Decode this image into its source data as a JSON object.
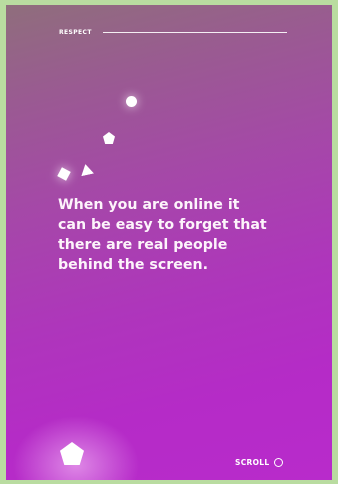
{
  "header": {
    "section_label": "RESPECT"
  },
  "main": {
    "quote_lines": [
      "When you are online it",
      "can be easy to forget that",
      "there are real people",
      "behind the screen."
    ]
  },
  "footer": {
    "scroll_label": "SCROLL",
    "scroll_icon": "circle-icon"
  },
  "colors": {
    "gradient_top": "#8f6e7c",
    "gradient_bottom": "#b82bcb",
    "text": "#ffffff"
  }
}
